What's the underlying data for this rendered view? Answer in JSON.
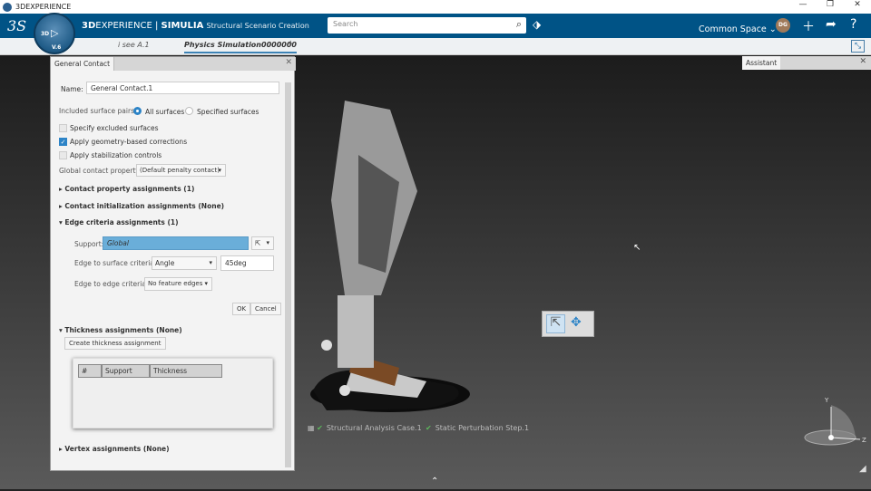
{
  "window": {
    "title": "3DEXPERIENCE",
    "minimize": "—",
    "restore": "❐",
    "close": "✕"
  },
  "header": {
    "brand_bold": "3D",
    "brand": "EXPERIENCE | ",
    "product": "SIMULIA",
    "app": "Structural Scenario Creation",
    "search_placeholder": "Search",
    "space": "Common Space",
    "avatar": "DG",
    "compass_version": "V.6",
    "compass_3d": "3D"
  },
  "tabs": [
    {
      "label": "i see A.1"
    },
    {
      "label": "Physics Simulation0000000"
    }
  ],
  "dialog": {
    "title": "General Contact",
    "name_label": "Name:",
    "name_value": "General Contact.1",
    "pairs_label": "Included surface pairs:",
    "pairs_options": [
      "All surfaces",
      "Specified surfaces"
    ],
    "checkboxes": [
      {
        "label": "Specify excluded surfaces",
        "checked": false
      },
      {
        "label": "Apply geometry-based corrections",
        "checked": true
      },
      {
        "label": "Apply stabilization controls",
        "checked": false
      }
    ],
    "global_prop_label": "Global contact property:",
    "global_prop_value": "(Default penalty contact)",
    "sections": [
      "Contact property assignments (1)",
      "Contact initialization assignments (None)",
      "Edge criteria assignments (1)",
      "Thickness assignments (None)",
      "Vertex assignments (None)"
    ],
    "support_label": "Support:",
    "support_value": "Global",
    "e2s_label": "Edge to surface criteria:",
    "e2s_value": "Angle",
    "e2s_angle": "45deg",
    "e2e_label": "Edge to edge criteria:",
    "e2e_value": "No feature edges",
    "ok": "OK",
    "cancel": "Cancel",
    "create_thickness": "Create thickness assignment",
    "table_headers": [
      "#",
      "Support",
      "Thickness"
    ]
  },
  "assistant": {
    "title": "Assistant"
  },
  "status": {
    "case": "Structural Analysis Case.1",
    "step": "Static Perturbation Step.1"
  },
  "triad": {
    "y": "Y",
    "z": "Z"
  }
}
